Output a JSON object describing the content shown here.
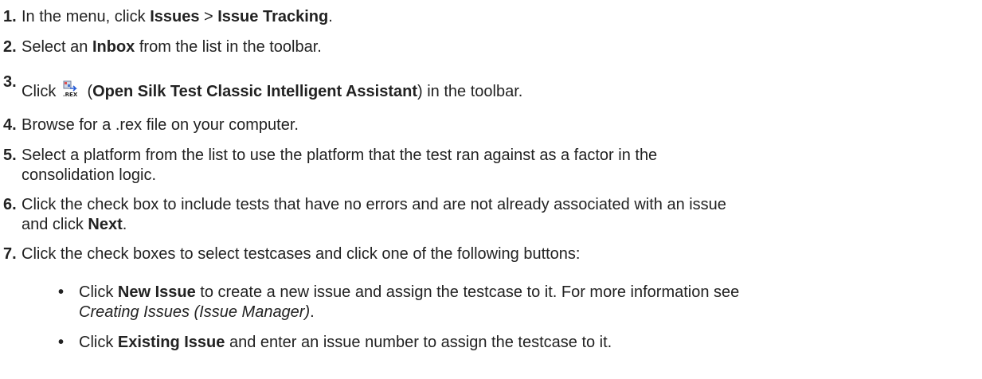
{
  "steps": [
    {
      "number": "1.",
      "parts": [
        "In the menu, click ",
        "Issues",
        " > ",
        "Issue Tracking",
        "."
      ]
    },
    {
      "number": "2.",
      "parts": [
        "Select an ",
        "Inbox",
        " from the list in the toolbar."
      ]
    },
    {
      "number": "3.",
      "parts": [
        "Click ",
        " (",
        "Open Silk Test Classic Intelligent Assistant",
        ") in the toolbar."
      ],
      "icon": "rex-file-icon"
    },
    {
      "number": "4.",
      "parts": [
        "Browse for a .rex file on your computer."
      ]
    },
    {
      "number": "5.",
      "parts": [
        "Select a platform from the list to use the platform that the test ran against as a factor in the",
        "consolidation logic."
      ]
    },
    {
      "number": "6.",
      "parts": [
        "Click the check box to include tests that have no errors and are not already associated with an issue",
        "and click ",
        "Next",
        "."
      ]
    },
    {
      "number": "7.",
      "parts": [
        "Click the check boxes to select testcases and click one of the following buttons:"
      ]
    }
  ],
  "bullets": [
    {
      "marker": "•",
      "parts": [
        "Click ",
        "New Issue",
        " to create a new issue and assign the testcase to it. For more information see",
        "Creating Issues (Issue Manager)",
        "."
      ]
    },
    {
      "marker": "•",
      "parts": [
        "Click ",
        "Existing Issue",
        " and enter an issue number to assign the testcase to it."
      ]
    }
  ]
}
